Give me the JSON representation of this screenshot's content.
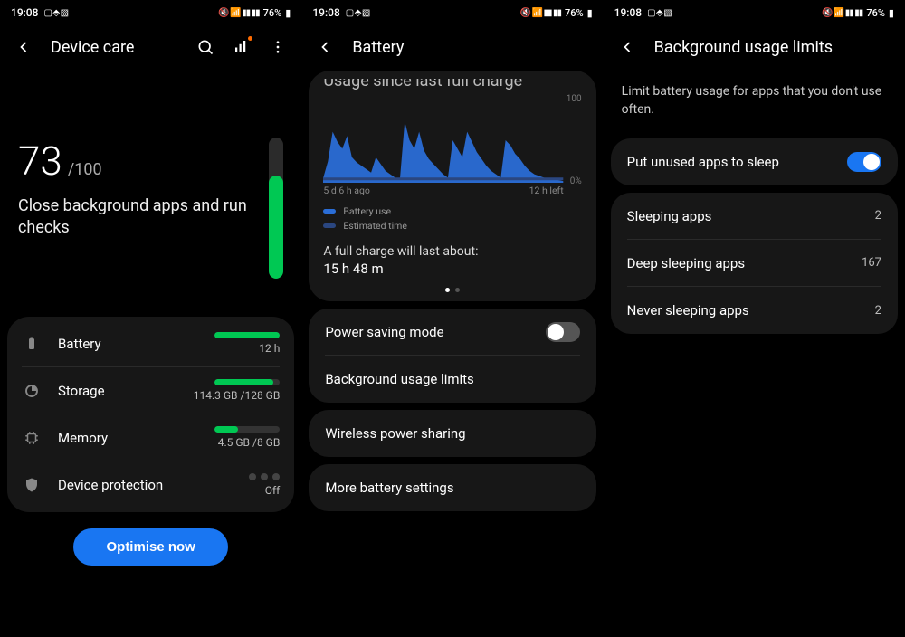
{
  "status": {
    "time": "19:08",
    "battery_pct": "76%"
  },
  "phone1": {
    "title": "Device care",
    "score": "73",
    "score_max": "/100",
    "subtitle": "Close background apps and run checks",
    "vbar_fill_pct": 73,
    "items": {
      "battery": {
        "label": "Battery",
        "value": "12 h",
        "fill_pct": 100
      },
      "storage": {
        "label": "Storage",
        "value": "114.3 GB /128 GB",
        "fill_pct": 90
      },
      "memory": {
        "label": "Memory",
        "value": "4.5 GB /8 GB",
        "fill_pct": 35
      },
      "device_protection": {
        "label": "Device protection",
        "value": "Off"
      }
    },
    "optimise_button": "Optimise now"
  },
  "phone2": {
    "title": "Battery",
    "chart_title_clipped": "Usage since last full charge",
    "chart_from": "5 d 6 h ago",
    "chart_to": "12 h left",
    "y_top": "100",
    "y_bottom": "0%",
    "legend": {
      "battery_use": "Battery use",
      "estimated_time": "Estimated time"
    },
    "full_charge_msg": "A full charge will last about:",
    "full_charge_val": "15 h 48 m",
    "options": {
      "power_saving": "Power saving mode",
      "power_saving_on": false,
      "bg_limits": "Background usage limits",
      "wireless_share": "Wireless power sharing",
      "more": "More battery settings"
    }
  },
  "phone3": {
    "title": "Background usage limits",
    "description": "Limit battery usage for apps that you don't use often.",
    "sleep_toggle_label": "Put unused apps to sleep",
    "sleep_toggle_on": true,
    "rows": {
      "sleeping": {
        "label": "Sleeping apps",
        "count": "2"
      },
      "deep": {
        "label": "Deep sleeping apps",
        "count": "167"
      },
      "never": {
        "label": "Never sleeping apps",
        "count": "2"
      }
    }
  },
  "chart_data": {
    "type": "area",
    "title": "Usage since last full charge",
    "xlabel": "",
    "ylabel": "%",
    "ylim": [
      0,
      100
    ],
    "x_range_label_start": "5 d 6 h ago",
    "x_range_label_end": "12 h left",
    "series": [
      {
        "name": "Battery use",
        "color": "#2a6dd6",
        "x": [
          0,
          2,
          4,
          6,
          8,
          10,
          12,
          14,
          16,
          18,
          20,
          22,
          24,
          26,
          28,
          30,
          32,
          34,
          36,
          38,
          40,
          42,
          44,
          46,
          48,
          50,
          52,
          54,
          56,
          58,
          60,
          62,
          64,
          66,
          68,
          70,
          72,
          74,
          76,
          78,
          80,
          82,
          84,
          86,
          88,
          90,
          92,
          94,
          96,
          98,
          100
        ],
        "values": [
          5,
          25,
          60,
          48,
          40,
          55,
          30,
          24,
          20,
          16,
          12,
          30,
          22,
          14,
          10,
          6,
          4,
          72,
          50,
          40,
          60,
          38,
          28,
          22,
          16,
          10,
          6,
          50,
          40,
          30,
          60,
          48,
          36,
          28,
          20,
          14,
          10,
          6,
          50,
          44,
          34,
          28,
          20,
          14,
          10,
          8,
          6,
          5,
          4,
          3,
          2
        ]
      },
      {
        "name": "Estimated time",
        "color": "#2a4680",
        "x": [
          0,
          100
        ],
        "values": [
          4,
          4
        ]
      }
    ]
  }
}
